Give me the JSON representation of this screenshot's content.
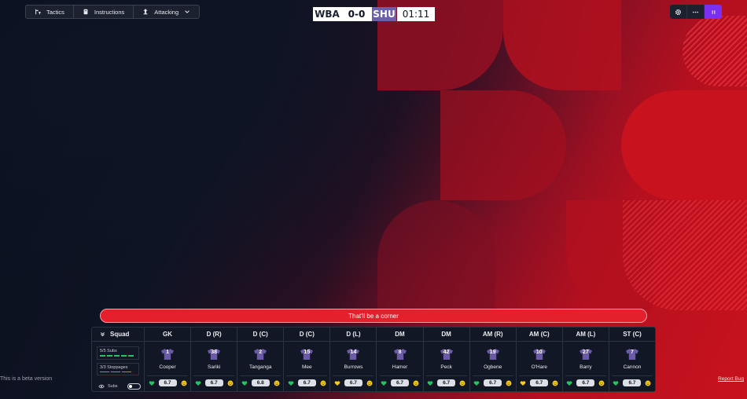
{
  "toolbar": {
    "tactics_label": "Tactics",
    "instructions_label": "Instructions",
    "mentality_label": "Attacking"
  },
  "scoreboard": {
    "home": "WBA",
    "score": "0-0",
    "away": "SHU",
    "clock": "01:11"
  },
  "commentary": "That'll be a corner",
  "squad": {
    "title": "Squad",
    "subs_info": "5/5 Subs",
    "stoppages_info": "3/3 Stoppages",
    "subs_toggle_label": "Subs",
    "players": [
      {
        "position": "GK",
        "number": "1",
        "name": "Cooper",
        "rating": "6.7"
      },
      {
        "position": "D (R)",
        "number": "38",
        "name": "Sariki",
        "rating": "6.7"
      },
      {
        "position": "D (C)",
        "number": "2",
        "name": "Tanganga",
        "rating": "6.8"
      },
      {
        "position": "D (C)",
        "number": "15",
        "name": "Mee",
        "rating": "6.7"
      },
      {
        "position": "D (L)",
        "number": "14",
        "name": "Burrows",
        "rating": "6.7"
      },
      {
        "position": "DM",
        "number": "8",
        "name": "Hamer",
        "rating": "6.7"
      },
      {
        "position": "DM",
        "number": "42",
        "name": "Peck",
        "rating": "6.7"
      },
      {
        "position": "AM (R)",
        "number": "19",
        "name": "Ogbene",
        "rating": "6.7"
      },
      {
        "position": "AM (C)",
        "number": "10",
        "name": "O'Hare",
        "rating": "6.7"
      },
      {
        "position": "AM (L)",
        "number": "27",
        "name": "Barry",
        "rating": "6.7"
      },
      {
        "position": "ST (C)",
        "number": "7",
        "name": "Cannon",
        "rating": "6.7"
      }
    ]
  },
  "footer": {
    "beta_note": "This is a beta version",
    "report_bug": "Report Bug"
  },
  "colors": {
    "accent_purple": "#7b2ff0",
    "away_badge": "#6e5da8",
    "banner_red": "#e3202b",
    "condition_green": "#22c55e",
    "condition_yellow": "#facc15"
  }
}
